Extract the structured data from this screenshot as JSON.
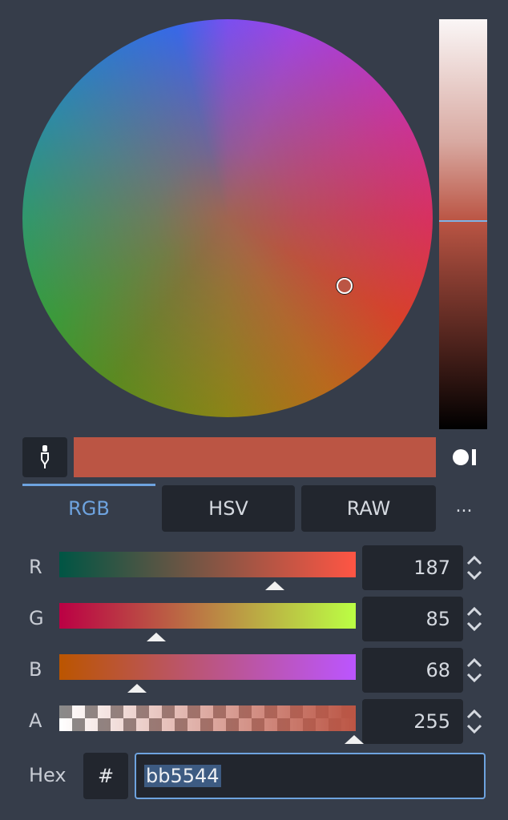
{
  "color": {
    "hex": "#bb5544",
    "accent": "#6ea3df",
    "background": "#363d4a"
  },
  "wheel": {
    "hue_deg": 8,
    "saturation": 0.64,
    "value": 0.73
  },
  "icons": {
    "picker": "eyedropper-icon",
    "sample_toggle": "sample-toggle-icon",
    "spin": "up-down-arrows-icon"
  },
  "tabs": [
    {
      "label": "RGB",
      "active": true
    },
    {
      "label": "HSV",
      "active": false
    },
    {
      "label": "RAW",
      "active": false
    }
  ],
  "more_label": "...",
  "channels": [
    {
      "label": "R",
      "value": "187",
      "level": 0.733
    },
    {
      "label": "G",
      "value": "85",
      "level": 0.333
    },
    {
      "label": "B",
      "value": "68",
      "level": 0.267
    },
    {
      "label": "A",
      "value": "255",
      "level": 1.0
    }
  ],
  "hex": {
    "label": "Hex",
    "hash_label": "#",
    "value": "bb5544"
  }
}
